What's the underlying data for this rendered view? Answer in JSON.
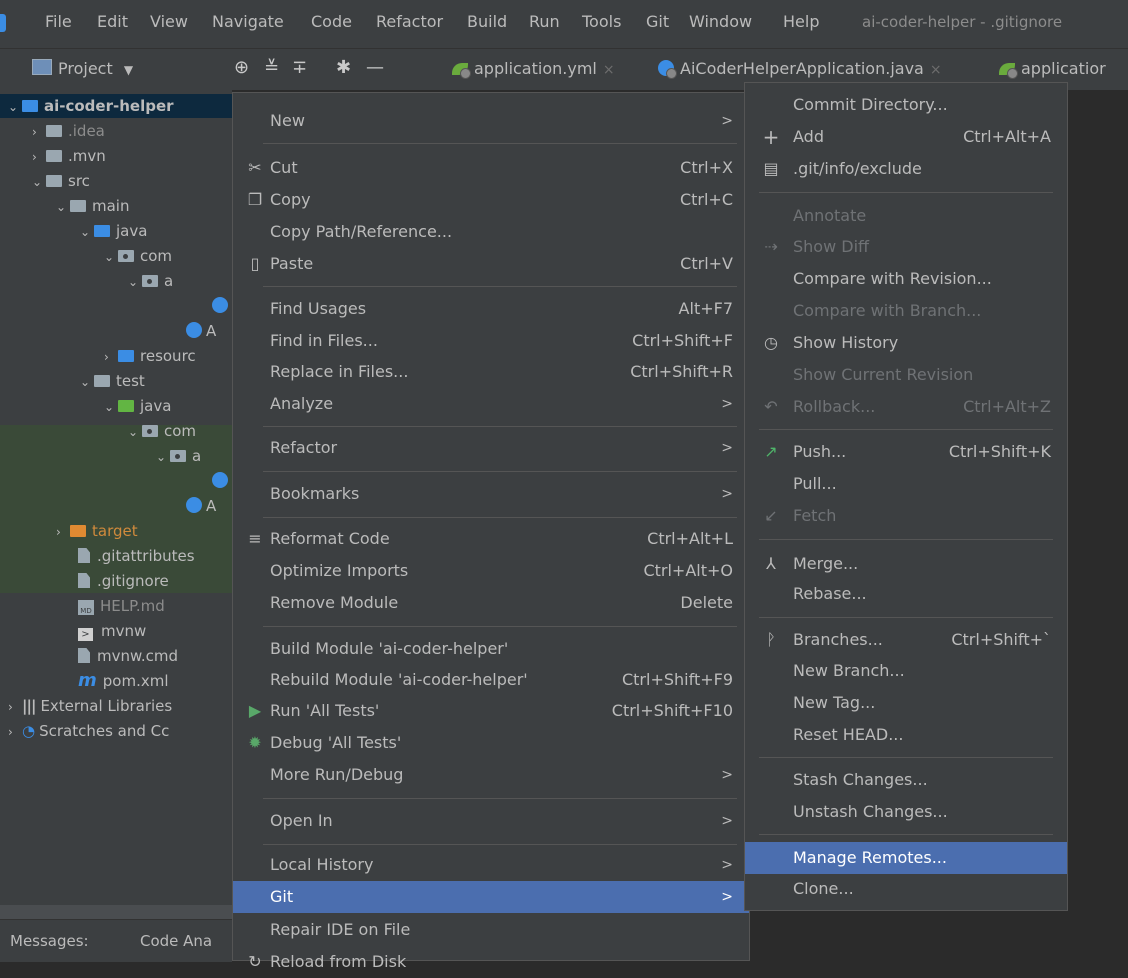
{
  "menubar": {
    "items": [
      "File",
      "Edit",
      "View",
      "Navigate",
      "Code",
      "Refactor",
      "Build",
      "Run",
      "Tools",
      "Git",
      "Window",
      "Help"
    ],
    "title": "ai-coder-helper - .gitignore"
  },
  "toolbar": {
    "project_label": "Project",
    "tabs": [
      {
        "label": "application.yml",
        "icon": "yml-leaf-icon"
      },
      {
        "label": "AiCoderHelperApplication.java",
        "icon": "java-class-icon"
      },
      {
        "label": "applicatior",
        "icon": "yml-leaf-icon"
      }
    ]
  },
  "tree": {
    "rows": [
      {
        "label": "ai-coder-helper",
        "icon": "module-folder-icon"
      },
      {
        "label": ".idea",
        "icon": "folder-icon"
      },
      {
        "label": ".mvn",
        "icon": "folder-icon"
      },
      {
        "label": "src",
        "icon": "folder-icon"
      },
      {
        "label": "main",
        "icon": "folder-icon"
      },
      {
        "label": "java",
        "icon": "source-folder-icon"
      },
      {
        "label": "com",
        "icon": "package-icon"
      },
      {
        "label": "a",
        "icon": "package-icon"
      },
      {
        "label": "",
        "icon": "class-icon"
      },
      {
        "label": "A",
        "icon": "spring-class-icon"
      },
      {
        "label": "resourc",
        "icon": "resources-folder-icon"
      },
      {
        "label": "test",
        "icon": "folder-icon"
      },
      {
        "label": "java",
        "icon": "test-folder-icon"
      },
      {
        "label": "com",
        "icon": "package-icon"
      },
      {
        "label": "a",
        "icon": "package-icon"
      },
      {
        "label": "",
        "icon": "class-icon"
      },
      {
        "label": "A",
        "icon": "spring-class-icon"
      },
      {
        "label": "target",
        "icon": "excluded-folder-icon"
      },
      {
        "label": ".gitattributes",
        "icon": "text-file-icon"
      },
      {
        "label": ".gitignore",
        "icon": "gitignore-file-icon"
      },
      {
        "label": "HELP.md",
        "icon": "markdown-file-icon"
      },
      {
        "label": "mvnw",
        "icon": "shell-file-icon"
      },
      {
        "label": "mvnw.cmd",
        "icon": "text-file-icon"
      },
      {
        "label": "pom.xml",
        "icon": "maven-icon"
      },
      {
        "label": "External Libraries",
        "icon": "library-icon"
      },
      {
        "label": "Scratches and Cc",
        "icon": "scratches-icon"
      }
    ]
  },
  "bottom": {
    "messages": "Messages:",
    "code_ana": "Code Ana"
  },
  "context_menu": {
    "new": "New",
    "cut": "Cut",
    "cut_sc": "Ctrl+X",
    "copy": "Copy",
    "copy_sc": "Ctrl+C",
    "copy_path": "Copy Path/Reference...",
    "paste": "Paste",
    "paste_sc": "Ctrl+V",
    "find_usages": "Find Usages",
    "find_usages_sc": "Alt+F7",
    "find_in_files": "Find in Files...",
    "find_in_files_sc": "Ctrl+Shift+F",
    "replace_in_files": "Replace in Files...",
    "replace_in_files_sc": "Ctrl+Shift+R",
    "analyze": "Analyze",
    "refactor": "Refactor",
    "bookmarks": "Bookmarks",
    "reformat": "Reformat Code",
    "reformat_sc": "Ctrl+Alt+L",
    "optimize": "Optimize Imports",
    "optimize_sc": "Ctrl+Alt+O",
    "remove_module": "Remove Module",
    "remove_module_sc": "Delete",
    "build_module": "Build Module 'ai-coder-helper'",
    "rebuild_module": "Rebuild Module 'ai-coder-helper'",
    "rebuild_module_sc": "Ctrl+Shift+F9",
    "run_tests": "Run 'All Tests'",
    "run_tests_sc": "Ctrl+Shift+F10",
    "debug_tests": "Debug 'All Tests'",
    "more_run": "More Run/Debug",
    "open_in": "Open In",
    "local_history": "Local History",
    "git": "Git",
    "repair": "Repair IDE on File",
    "reload": "Reload from Disk"
  },
  "git_menu": {
    "commit_dir": "Commit Directory...",
    "add": "Add",
    "add_sc": "Ctrl+Alt+A",
    "exclude": ".git/info/exclude",
    "annotate": "Annotate",
    "show_diff": "Show Diff",
    "compare_revision": "Compare with Revision...",
    "compare_branch": "Compare with Branch...",
    "show_history": "Show History",
    "show_current": "Show Current Revision",
    "rollback": "Rollback...",
    "rollback_sc": "Ctrl+Alt+Z",
    "push": "Push...",
    "push_sc": "Ctrl+Shift+K",
    "pull": "Pull...",
    "fetch": "Fetch",
    "merge": "Merge...",
    "rebase": "Rebase...",
    "branches": "Branches...",
    "branches_sc": "Ctrl+Shift+`",
    "new_branch": "New Branch...",
    "new_tag": "New Tag...",
    "reset_head": "Reset HEAD...",
    "stash": "Stash Changes...",
    "unstash": "Unstash Changes...",
    "manage_remotes": "Manage Remotes...",
    "clone": "Clone..."
  },
  "colors": {
    "menu_bg": "#3c3f41",
    "highlight": "#4b6eaf",
    "editor_bg": "#2b2b2b",
    "disabled_text": "#6f7275"
  }
}
